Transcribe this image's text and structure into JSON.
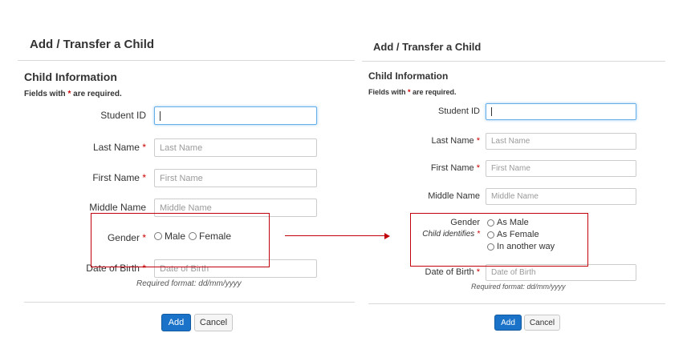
{
  "left": {
    "title": "Add / Transfer a Child",
    "section_title": "Child Information",
    "required_note": {
      "prefix": "Fields with ",
      "star": "*",
      "suffix": " are required."
    },
    "fields": {
      "student_id": {
        "label": "Student ID",
        "value": ""
      },
      "last_name": {
        "label": "Last Name",
        "star": "*",
        "placeholder": "Last Name"
      },
      "first_name": {
        "label": "First Name",
        "star": "*",
        "placeholder": "First Name"
      },
      "middle_name": {
        "label": "Middle Name",
        "placeholder": "Middle Name"
      },
      "gender": {
        "label": "Gender",
        "star": "*",
        "options": [
          "Male",
          "Female"
        ]
      },
      "dob": {
        "label": "Date of Birth",
        "star": "*",
        "placeholder": "Date of Birth",
        "hint": "Required format: dd/mm/yyyy"
      }
    },
    "buttons": {
      "add": "Add",
      "cancel": "Cancel"
    }
  },
  "right": {
    "title": "Add / Transfer a Child",
    "section_title": "Child Information",
    "required_note": {
      "prefix": "Fields with ",
      "star": "*",
      "suffix": " are required."
    },
    "fields": {
      "student_id": {
        "label": "Student ID",
        "value": ""
      },
      "last_name": {
        "label": "Last Name",
        "star": "*",
        "placeholder": "Last Name"
      },
      "first_name": {
        "label": "First Name",
        "star": "*",
        "placeholder": "First Name"
      },
      "middle_name": {
        "label": "Middle Name",
        "placeholder": "Middle Name"
      },
      "gender": {
        "label": "Gender",
        "sublabel": "Child identifies",
        "star": "*",
        "options": [
          "As Male",
          "As Female",
          "In another way"
        ]
      },
      "dob": {
        "label": "Date of Birth",
        "star": "*",
        "placeholder": "Date of Birth",
        "hint": "Required format: dd/mm/yyyy"
      }
    },
    "buttons": {
      "add": "Add",
      "cancel": "Cancel"
    }
  },
  "colors": {
    "annotation": "#c0000a",
    "primary_button": "#1a73c9",
    "required_star": "#cc0000",
    "focus_border": "#66afe9"
  }
}
